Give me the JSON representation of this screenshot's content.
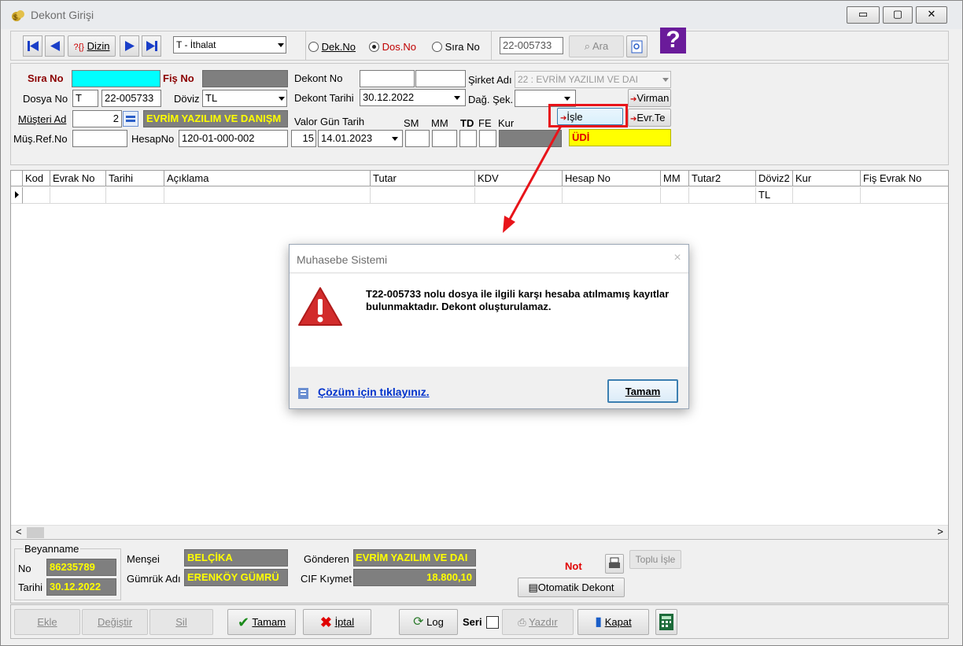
{
  "window": {
    "title": "Dekont Girişi",
    "min": "▭",
    "max": "▢",
    "close": "✕"
  },
  "toolbar": {
    "dizin_label": "Dizin",
    "dizin_prefix": "?{}",
    "type_select": "T - İthalat",
    "radio_dek": "Dek.No",
    "radio_dos": "Dos.No",
    "radio_sira": "Sıra No",
    "search_value": "22-005733",
    "search_label": "Ara",
    "help_glyph": "?"
  },
  "form": {
    "sira_no_label": "Sıra No",
    "fis_no_label": "Fiş No",
    "dosya_no_label": "Dosya No",
    "dosya_prefix": "T",
    "dosya_value": "22-005733",
    "doviz_label": "Döviz",
    "doviz_value": "TL",
    "musteri_ad_label": "Müşteri Ad",
    "musteri_no": "2",
    "musteri_name": "EVRİM YAZILIM VE DANIŞM",
    "mus_ref_label": "Müş.Ref.No",
    "hesap_no_label": "HesapNo",
    "hesap_no_value": "120-01-000-002",
    "dekont_no_label": "Dekont No",
    "dekont_tarihi_label": "Dekont Tarihi",
    "dekont_tarihi_value": "30.12.2022",
    "valor_label": "Valor Gün Tarih",
    "valor_gun": "15",
    "valor_tarih": "14.01.2023",
    "sm_label": "SM",
    "mm_label": "MM",
    "td_label": "TD",
    "fe_label": "FE",
    "kur_label": "Kur",
    "sirket_adi_label": "Şirket Adı",
    "sirket_value": "22 : EVRİM YAZILIM  VE DAI",
    "dag_sek_label": "Dağ. Şek.",
    "isle_label": "İşle",
    "virman_label": "Virman",
    "evr_label": "Evr.Te",
    "udi_value": "ÜDİ"
  },
  "grid": {
    "columns": [
      "Kod",
      "Evrak No",
      "Tarihi",
      "Açıklama",
      "Tutar",
      "KDV",
      "Hesap No",
      "MM",
      "Tutar2",
      "Döviz2",
      "Kur",
      "Fiş Evrak No"
    ],
    "row": {
      "doviz2": "TL"
    },
    "scroll_left": "<",
    "scroll_right": ">"
  },
  "beyanname": {
    "title": "Beyanname",
    "no_label": "No",
    "no_value": "86235789",
    "tarihi_label": "Tarihi",
    "tarihi_value": "30.12.2022",
    "mensei_label": "Menşei",
    "mensei_value": "BELÇİKA",
    "gumruk_label": "Gümrük Adı",
    "gumruk_value": "ERENKÖY GÜMRÜ",
    "gonderen_label": "Gönderen",
    "gonderen_value": "EVRİM YAZILIM VE DAI",
    "cif_label": "CIF Kıymet",
    "cif_value": "18.800,10",
    "not_label": "Not",
    "toplu_isle": "Toplu İşle",
    "otomatik_dekont": "Otomatik Dekont"
  },
  "bottom": {
    "ekle": "Ekle",
    "degistir": "Değiştir",
    "sil": "Sil",
    "tamam": "Tamam",
    "iptal": "İptal",
    "log": "Log",
    "seri": "Seri",
    "yazdir": "Yazdır",
    "kapat": "Kapat"
  },
  "dialog": {
    "title": "Muhasebe Sistemi",
    "message": "T22-005733 nolu dosya ile ilgili karşı hesaba atılmamış kayıtlar bulunmaktadır. Dekont oluşturulamaz.",
    "help_link": "Çözüm için tıklayınız.",
    "ok": "Tamam",
    "close": "×"
  },
  "colors": {
    "accent_red": "#e8141a",
    "cyan": "#00ffff",
    "yellow": "#ffff00",
    "label_red": "#8b0000",
    "dark_field": "#7f7f7f",
    "link": "#0033cc"
  }
}
